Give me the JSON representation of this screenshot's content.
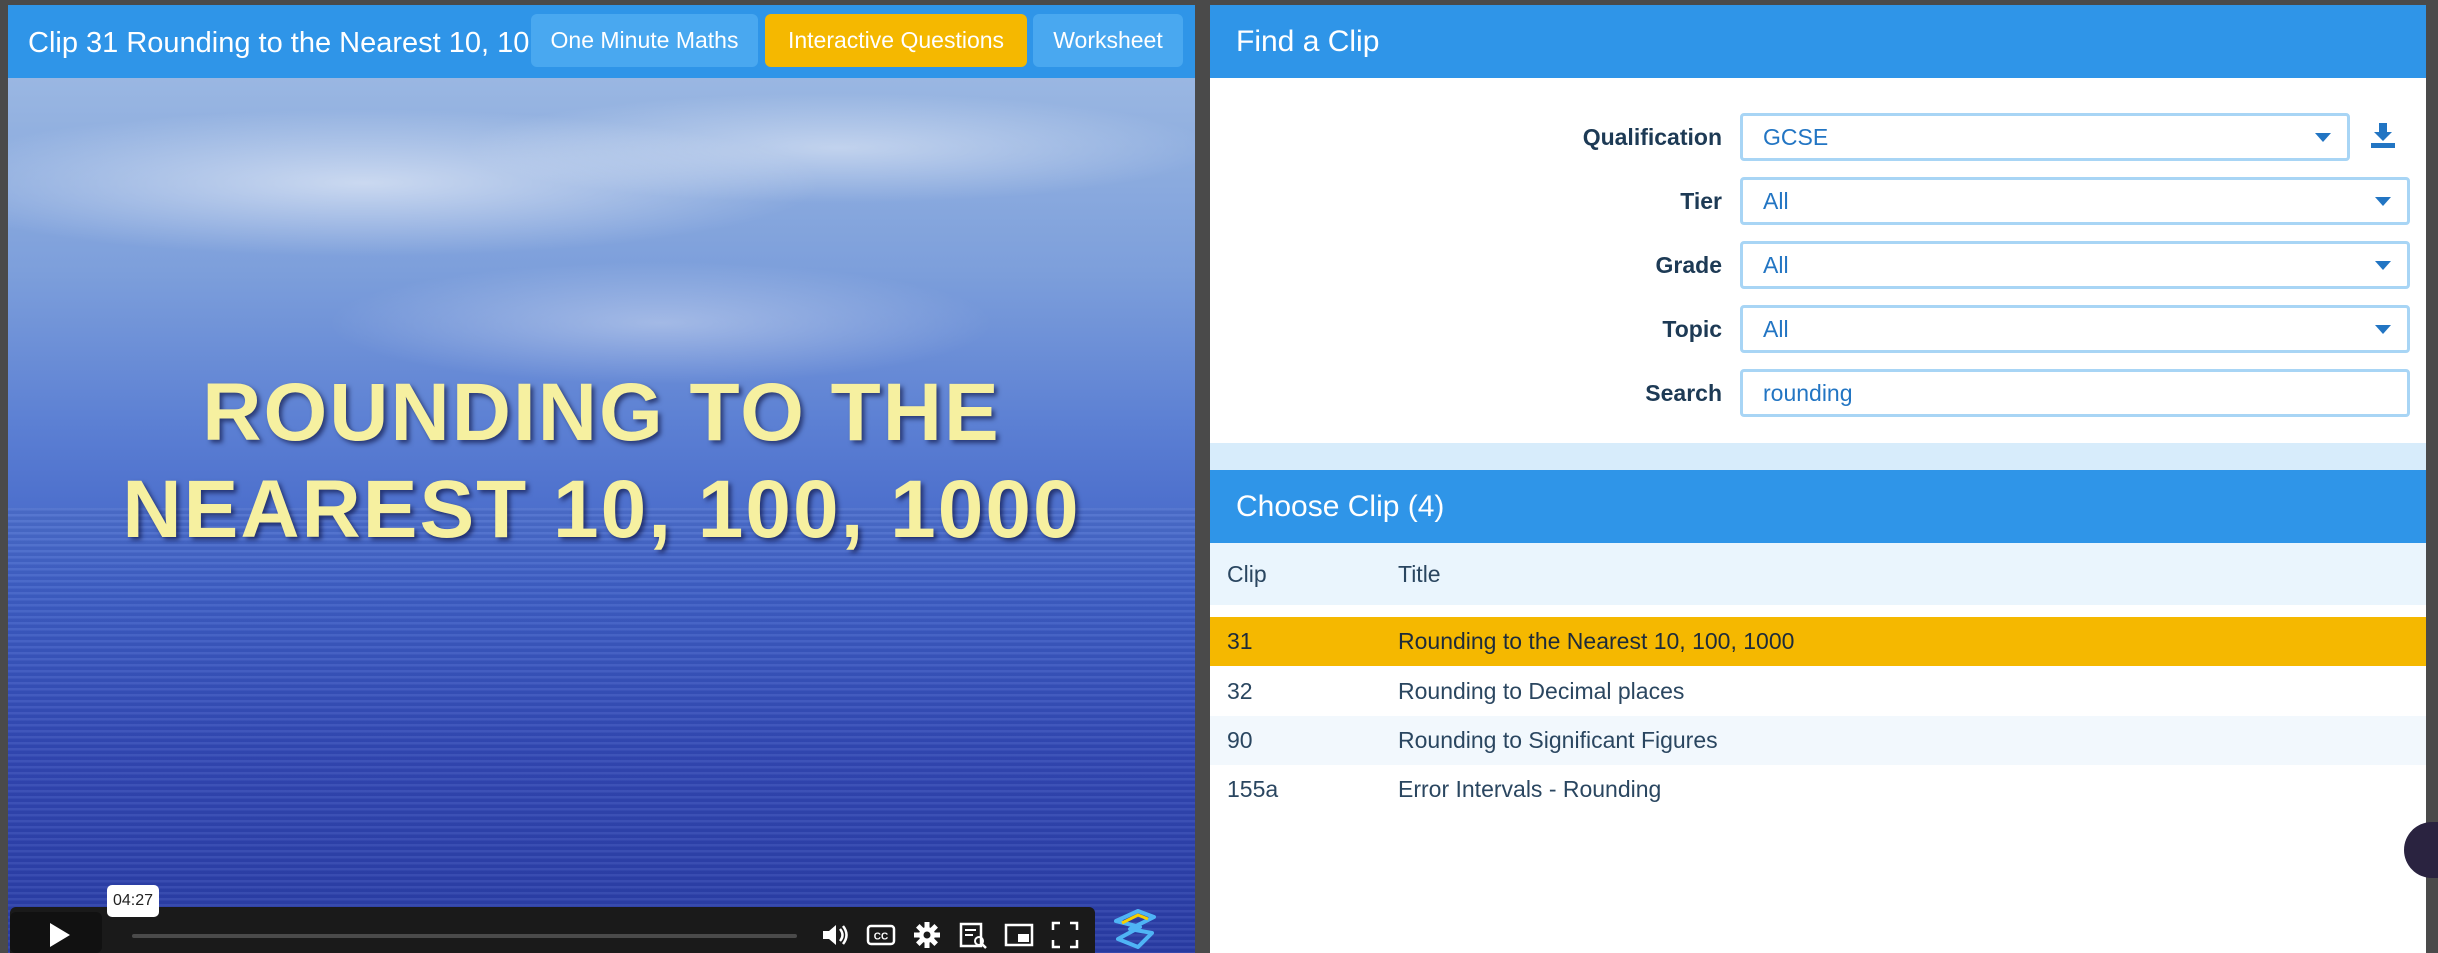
{
  "video": {
    "clip_title": "Clip 31 Rounding to the Nearest 10, 10",
    "buttons": {
      "one_minute": "One Minute Maths",
      "interactive": "Interactive Questions",
      "worksheet": "Worksheet"
    },
    "title_line_1": "ROUNDING TO THE",
    "title_line_2": "NEAREST 10, 100, 1000",
    "time_tooltip": "04:27",
    "controls": [
      "play-icon",
      "volume-icon",
      "captions-icon",
      "settings-icon",
      "chapters-icon",
      "miniplayer-icon",
      "fullscreen-icon"
    ],
    "colors": {
      "header": "#2f95e8",
      "accent": "#f5b800"
    }
  },
  "find_clip": {
    "header": "Find a Clip",
    "fields": [
      {
        "label": "Qualification",
        "value": "GCSE"
      },
      {
        "label": "Tier",
        "value": "All"
      },
      {
        "label": "Grade",
        "value": "All"
      },
      {
        "label": "Topic",
        "value": "All"
      },
      {
        "label": "Search",
        "value": "rounding"
      }
    ]
  },
  "choose_clip": {
    "header": "Choose Clip (4)",
    "columns": [
      "Clip",
      "Title"
    ],
    "rows": [
      {
        "clip": "31",
        "title": "Rounding to the Nearest 10, 100, 1000",
        "selected": true
      },
      {
        "clip": "32",
        "title": "Rounding to Decimal places"
      },
      {
        "clip": "90",
        "title": "Rounding to Significant Figures"
      },
      {
        "clip": "155a",
        "title": "Error Intervals - Rounding"
      }
    ]
  }
}
